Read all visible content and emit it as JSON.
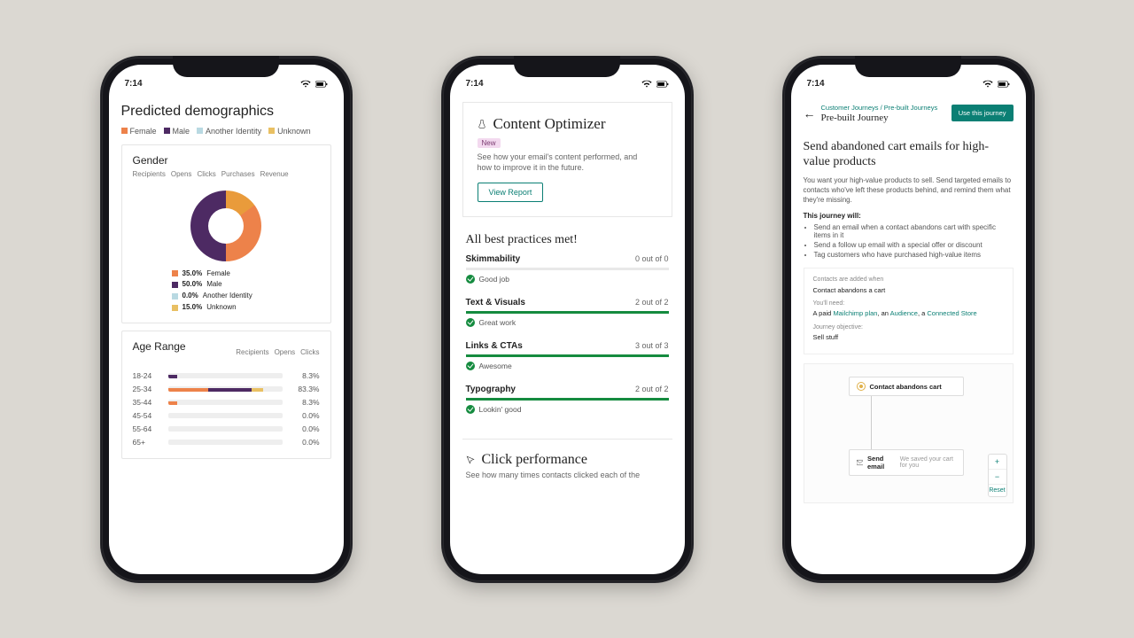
{
  "status": {
    "time": "7:14"
  },
  "colors": {
    "female": "#ed824a",
    "male": "#4d2a63",
    "another": "#b9d9e2",
    "unknown": "#e9c063",
    "teal": "#0b7f74",
    "green": "#158b3f"
  },
  "phone1": {
    "title": "Predicted demographics",
    "legend": [
      "Female",
      "Male",
      "Another Identity",
      "Unknown"
    ],
    "gender_card": {
      "title": "Gender",
      "metrics": [
        "Recipients",
        "Opens",
        "Clicks",
        "Purchases",
        "Revenue"
      ],
      "legend_lines": [
        {
          "pct": "35.0%",
          "label": "Female",
          "color": "#ed824a"
        },
        {
          "pct": "50.0%",
          "label": "Male",
          "color": "#4d2a63"
        },
        {
          "pct": "0.0%",
          "label": "Another Identity",
          "color": "#b9d9e2"
        },
        {
          "pct": "15.0%",
          "label": "Unknown",
          "color": "#e9c063"
        }
      ]
    },
    "age_card": {
      "title": "Age Range",
      "metrics": [
        "Recipients",
        "Opens",
        "Clicks"
      ],
      "rows": [
        {
          "label": "18-24",
          "pct": "8.3%"
        },
        {
          "label": "25-34",
          "pct": "83.3%"
        },
        {
          "label": "35-44",
          "pct": "8.3%"
        },
        {
          "label": "45-54",
          "pct": "0.0%"
        },
        {
          "label": "55-64",
          "pct": "0.0%"
        },
        {
          "label": "65+",
          "pct": "0.0%"
        }
      ]
    }
  },
  "phone2": {
    "optimizer": {
      "title": "Content Optimizer",
      "badge": "New",
      "desc": "See how your email's content performed, and how to improve it in the future.",
      "button": "View Report"
    },
    "best_title": "All best practices met!",
    "practices": [
      {
        "name": "Skimmability",
        "count": "0 out of 0",
        "msg": "Good job",
        "green": false
      },
      {
        "name": "Text & Visuals",
        "count": "2 out of 2",
        "msg": "Great work",
        "green": true
      },
      {
        "name": "Links & CTAs",
        "count": "3 out of 3",
        "msg": "Awesome",
        "green": true
      },
      {
        "name": "Typography",
        "count": "2 out of 2",
        "msg": "Lookin' good",
        "green": true
      }
    ],
    "click_perf": {
      "title": "Click performance",
      "desc": "See how many times contacts clicked each of the"
    }
  },
  "phone3": {
    "breadcrumb": "Customer Journeys / Pre-built Journeys",
    "page": "Pre-built Journey",
    "cta": "Use this journey",
    "h1": "Send abandoned cart emails for high-value products",
    "body": "You want your high-value products to sell. Send targeted emails to contacts who've left these products behind, and remind them what they're missing.",
    "sub": "This journey will:",
    "bullets": [
      "Send an email when a contact abandons cart with specific items in it",
      "Send a follow up email with a special offer or discount",
      "Tag customers who have purchased high-value items"
    ],
    "info": {
      "l1": "Contacts are added when",
      "v1": "Contact abandons a cart",
      "l2": "You'll need:",
      "v2a": "A paid ",
      "v2b": "Mailchimp plan",
      "v2c": ", an ",
      "v2d": "Audience",
      "v2e": ", a ",
      "v2f": "Connected Store",
      "l3": "Journey objective:",
      "v3": "Sell stuff"
    },
    "flow": {
      "node1": "Contact abandons cart",
      "node2_title": "Send email",
      "node2_sub": "We saved your cart for you",
      "zoom_plus": "+",
      "zoom_minus": "−",
      "zoom_reset": "Reset"
    }
  },
  "chart_data": [
    {
      "type": "pie",
      "title": "Gender",
      "series": [
        {
          "name": "Female",
          "value": 35.0
        },
        {
          "name": "Male",
          "value": 50.0
        },
        {
          "name": "Another Identity",
          "value": 0.0
        },
        {
          "name": "Unknown",
          "value": 15.0
        }
      ]
    },
    {
      "type": "bar",
      "title": "Age Range",
      "categories": [
        "18-24",
        "25-34",
        "35-44",
        "45-54",
        "55-64",
        "65+"
      ],
      "values": [
        8.3,
        83.3,
        8.3,
        0.0,
        0.0,
        0.0
      ],
      "ylim": [
        0,
        100
      ]
    }
  ]
}
